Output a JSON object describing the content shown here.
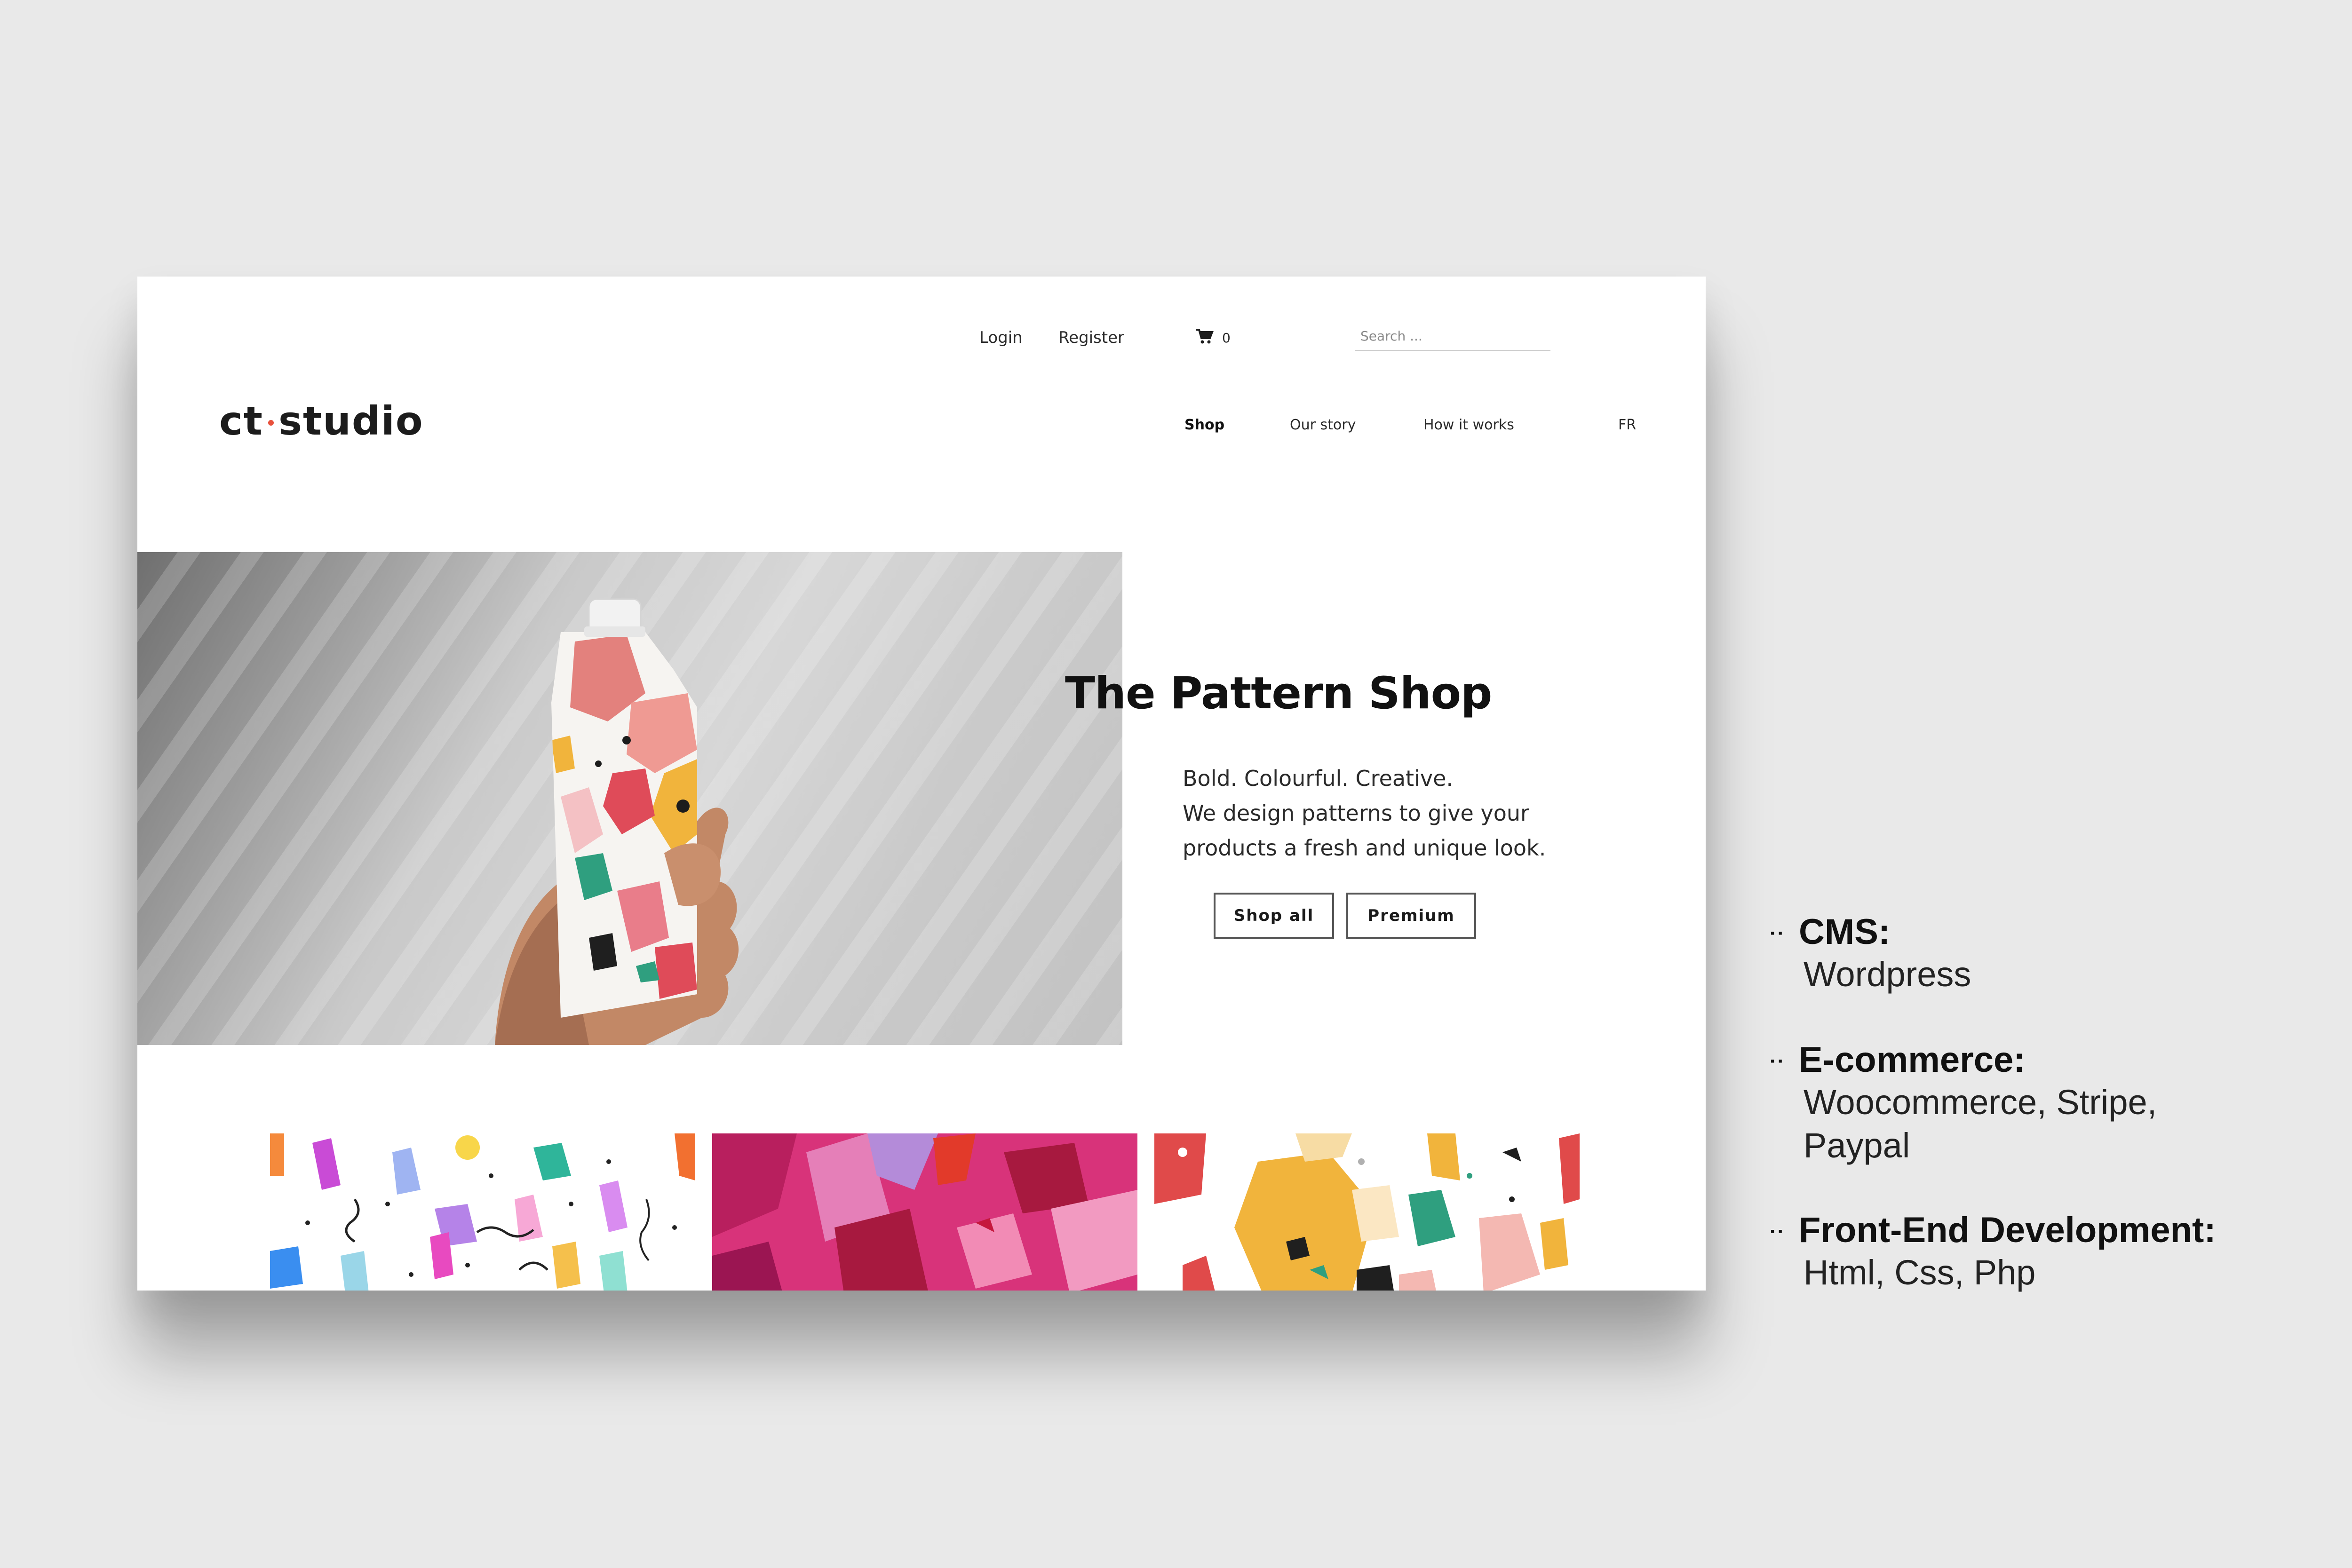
{
  "header": {
    "login_label": "Login",
    "register_label": "Register",
    "cart_count": "0",
    "search_placeholder": "Search ...",
    "logo_left": "ct",
    "logo_right": "studio",
    "nav": [
      {
        "label": "Shop",
        "active": true
      },
      {
        "label": "Our story",
        "active": false
      },
      {
        "label": "How it works",
        "active": false
      }
    ],
    "language": "FR"
  },
  "hero": {
    "title": "The Pattern Shop",
    "lines": [
      "Bold. Colourful. Creative.",
      "We design patterns to give your",
      "products a fresh and unique look."
    ],
    "primary_button": "Shop all",
    "secondary_button": "Premium"
  },
  "tech_list": [
    {
      "heading": "CMS:",
      "lines": [
        "Wordpress"
      ]
    },
    {
      "heading": "E-commerce:",
      "lines": [
        "Woocommerce, Stripe,",
        "Paypal"
      ]
    },
    {
      "heading": "Front-End Development:",
      "lines": [
        "Html, Css, Php"
      ]
    }
  ],
  "icons": {
    "cart": "cart-icon",
    "bullet": "double-dot-bullet-icon"
  },
  "colors": {
    "accent": "#e8513c",
    "pink": "#d8337a",
    "yellow": "#f1b43c"
  }
}
